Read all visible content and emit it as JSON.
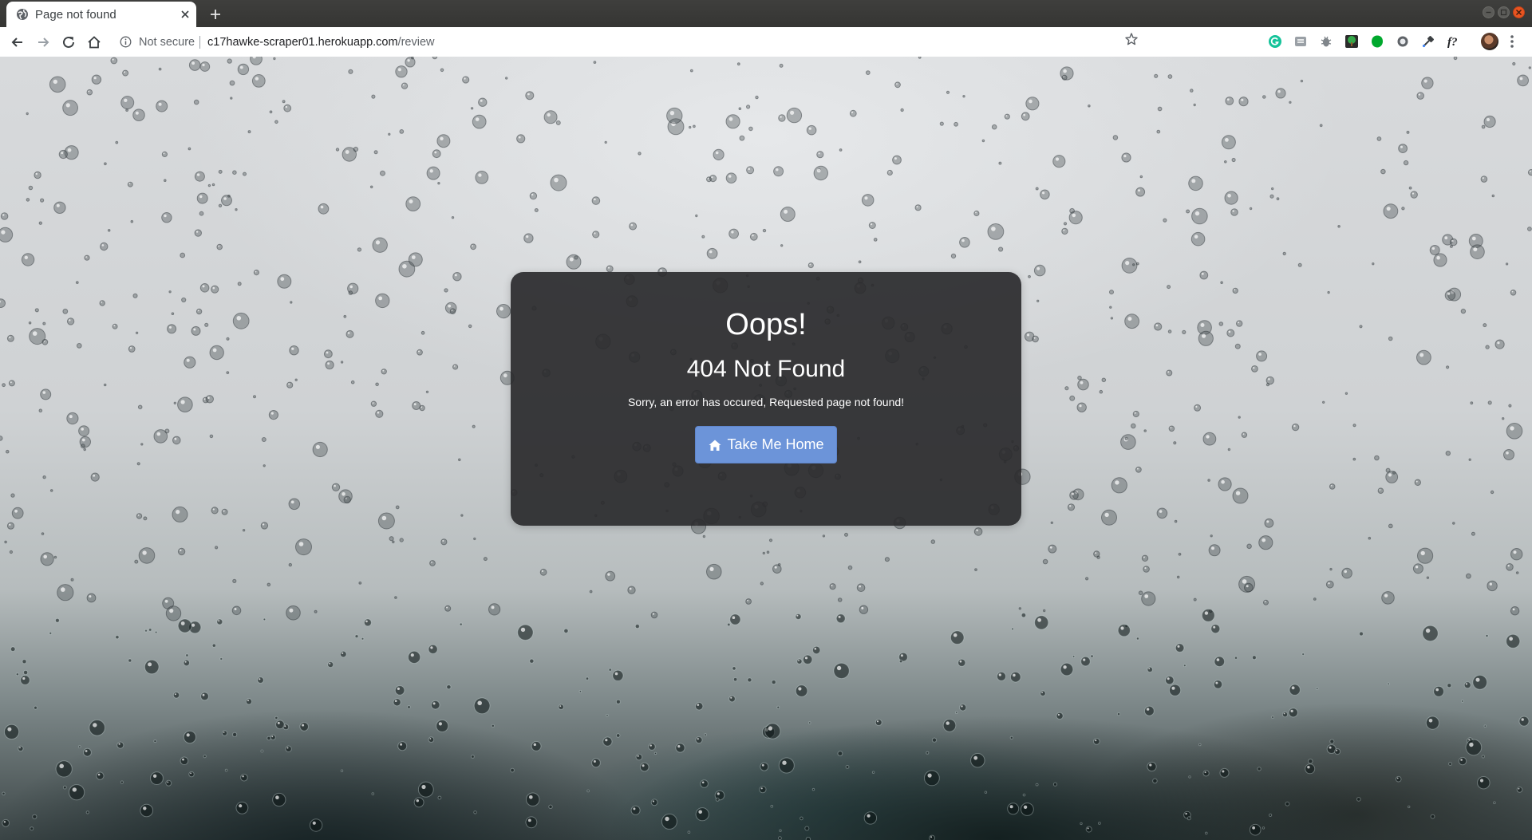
{
  "browser": {
    "tab_title": "Page not found",
    "security_label": "Not secure",
    "url_host": "c17hawke-scraper01.herokuapp.com",
    "url_path": "/review",
    "icons": [
      "globe-icon",
      "close-icon",
      "plus-icon",
      "back-icon",
      "forward-icon",
      "reload-icon",
      "home-icon",
      "info-icon",
      "star-icon",
      "menu-icon"
    ],
    "extensions": [
      "grammarly-extension-icon",
      "reader-extension-icon",
      "bug-extension-icon",
      "tree-extension-icon",
      "evernote-extension-icon",
      "circle-extension-icon",
      "eyedropper-extension-icon",
      "fonts-extension-icon"
    ]
  },
  "error_card": {
    "heading": "Oops!",
    "subheading": "404 Not Found",
    "message": "Sorry, an error has occured, Requested page not found!",
    "button_label": "Take Me Home",
    "button_icon": "home-icon"
  },
  "colors": {
    "card_background": "#2a2a2c",
    "button_background": "#6c94d9",
    "window_close": "#e95420"
  }
}
